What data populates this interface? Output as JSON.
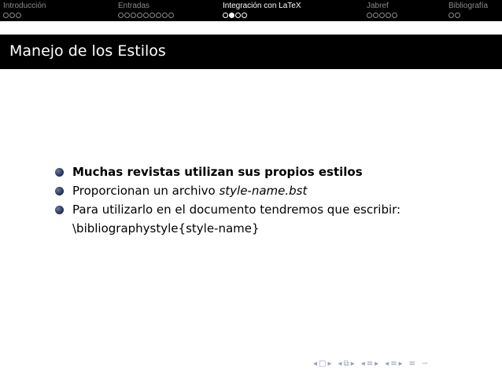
{
  "navbar": {
    "sections": [
      {
        "title": "Introducción",
        "dots": 3,
        "current": -1,
        "active": false
      },
      {
        "title": "Entradas",
        "dots": 9,
        "current": -1,
        "active": false
      },
      {
        "title": "Integración con LaTeX",
        "dots": 4,
        "current": 1,
        "active": true
      },
      {
        "title": "Jabref",
        "dots": 5,
        "current": -1,
        "active": false
      },
      {
        "title": "Bibliografía",
        "dots": 2,
        "current": -1,
        "active": false
      }
    ]
  },
  "frame": {
    "title": "Manejo de los Estilos"
  },
  "bullets": [
    {
      "text": "Muchas revistas utilizan sus propios estilos"
    },
    {
      "prefix": "Proporcionan un archivo ",
      "italic": "style-name.bst"
    },
    {
      "line1": "Para utilizarlo en el documento tendremos que escribir:",
      "line2": "\\bibliographystyle{style-name}"
    }
  ],
  "beamer_controls": {
    "slide_prev": "◂",
    "slide_icon": "□",
    "slide_next": "▸",
    "frame_prev": "◂",
    "frame_icon": "⧉",
    "frame_next": "▸",
    "subsection_prev": "◂",
    "subsection_icon": "≡",
    "subsection_next": "▸",
    "section_prev": "◂",
    "section_icon": "≡",
    "section_next": "▸",
    "align_icon": "≡",
    "search_icon": "∽",
    "colors": {
      "controls": "#9aa0b8"
    }
  }
}
